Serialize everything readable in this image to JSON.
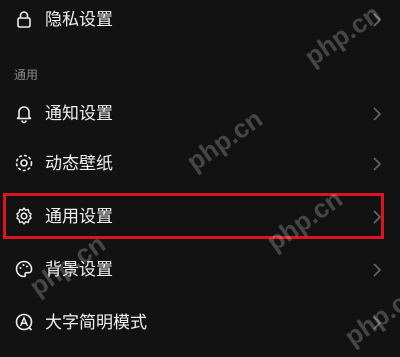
{
  "section_header": "通用",
  "rows": [
    {
      "label": "隐私设置",
      "icon": "lock-icon"
    },
    {
      "label": "通知设置",
      "icon": "bell-icon"
    },
    {
      "label": "动态壁纸",
      "icon": "wallpaper-icon"
    },
    {
      "label": "通用设置",
      "icon": "gear-icon"
    },
    {
      "label": "背景设置",
      "icon": "palette-icon"
    },
    {
      "label": "大字简明模式",
      "icon": "font-size-icon"
    }
  ],
  "highlighted_row": "通用设置",
  "watermark": "php.cn",
  "colors": {
    "background": "#121212",
    "text": "#f2f2f2",
    "section_header": "#8a8a8a",
    "highlight_border": "#d9161f"
  }
}
